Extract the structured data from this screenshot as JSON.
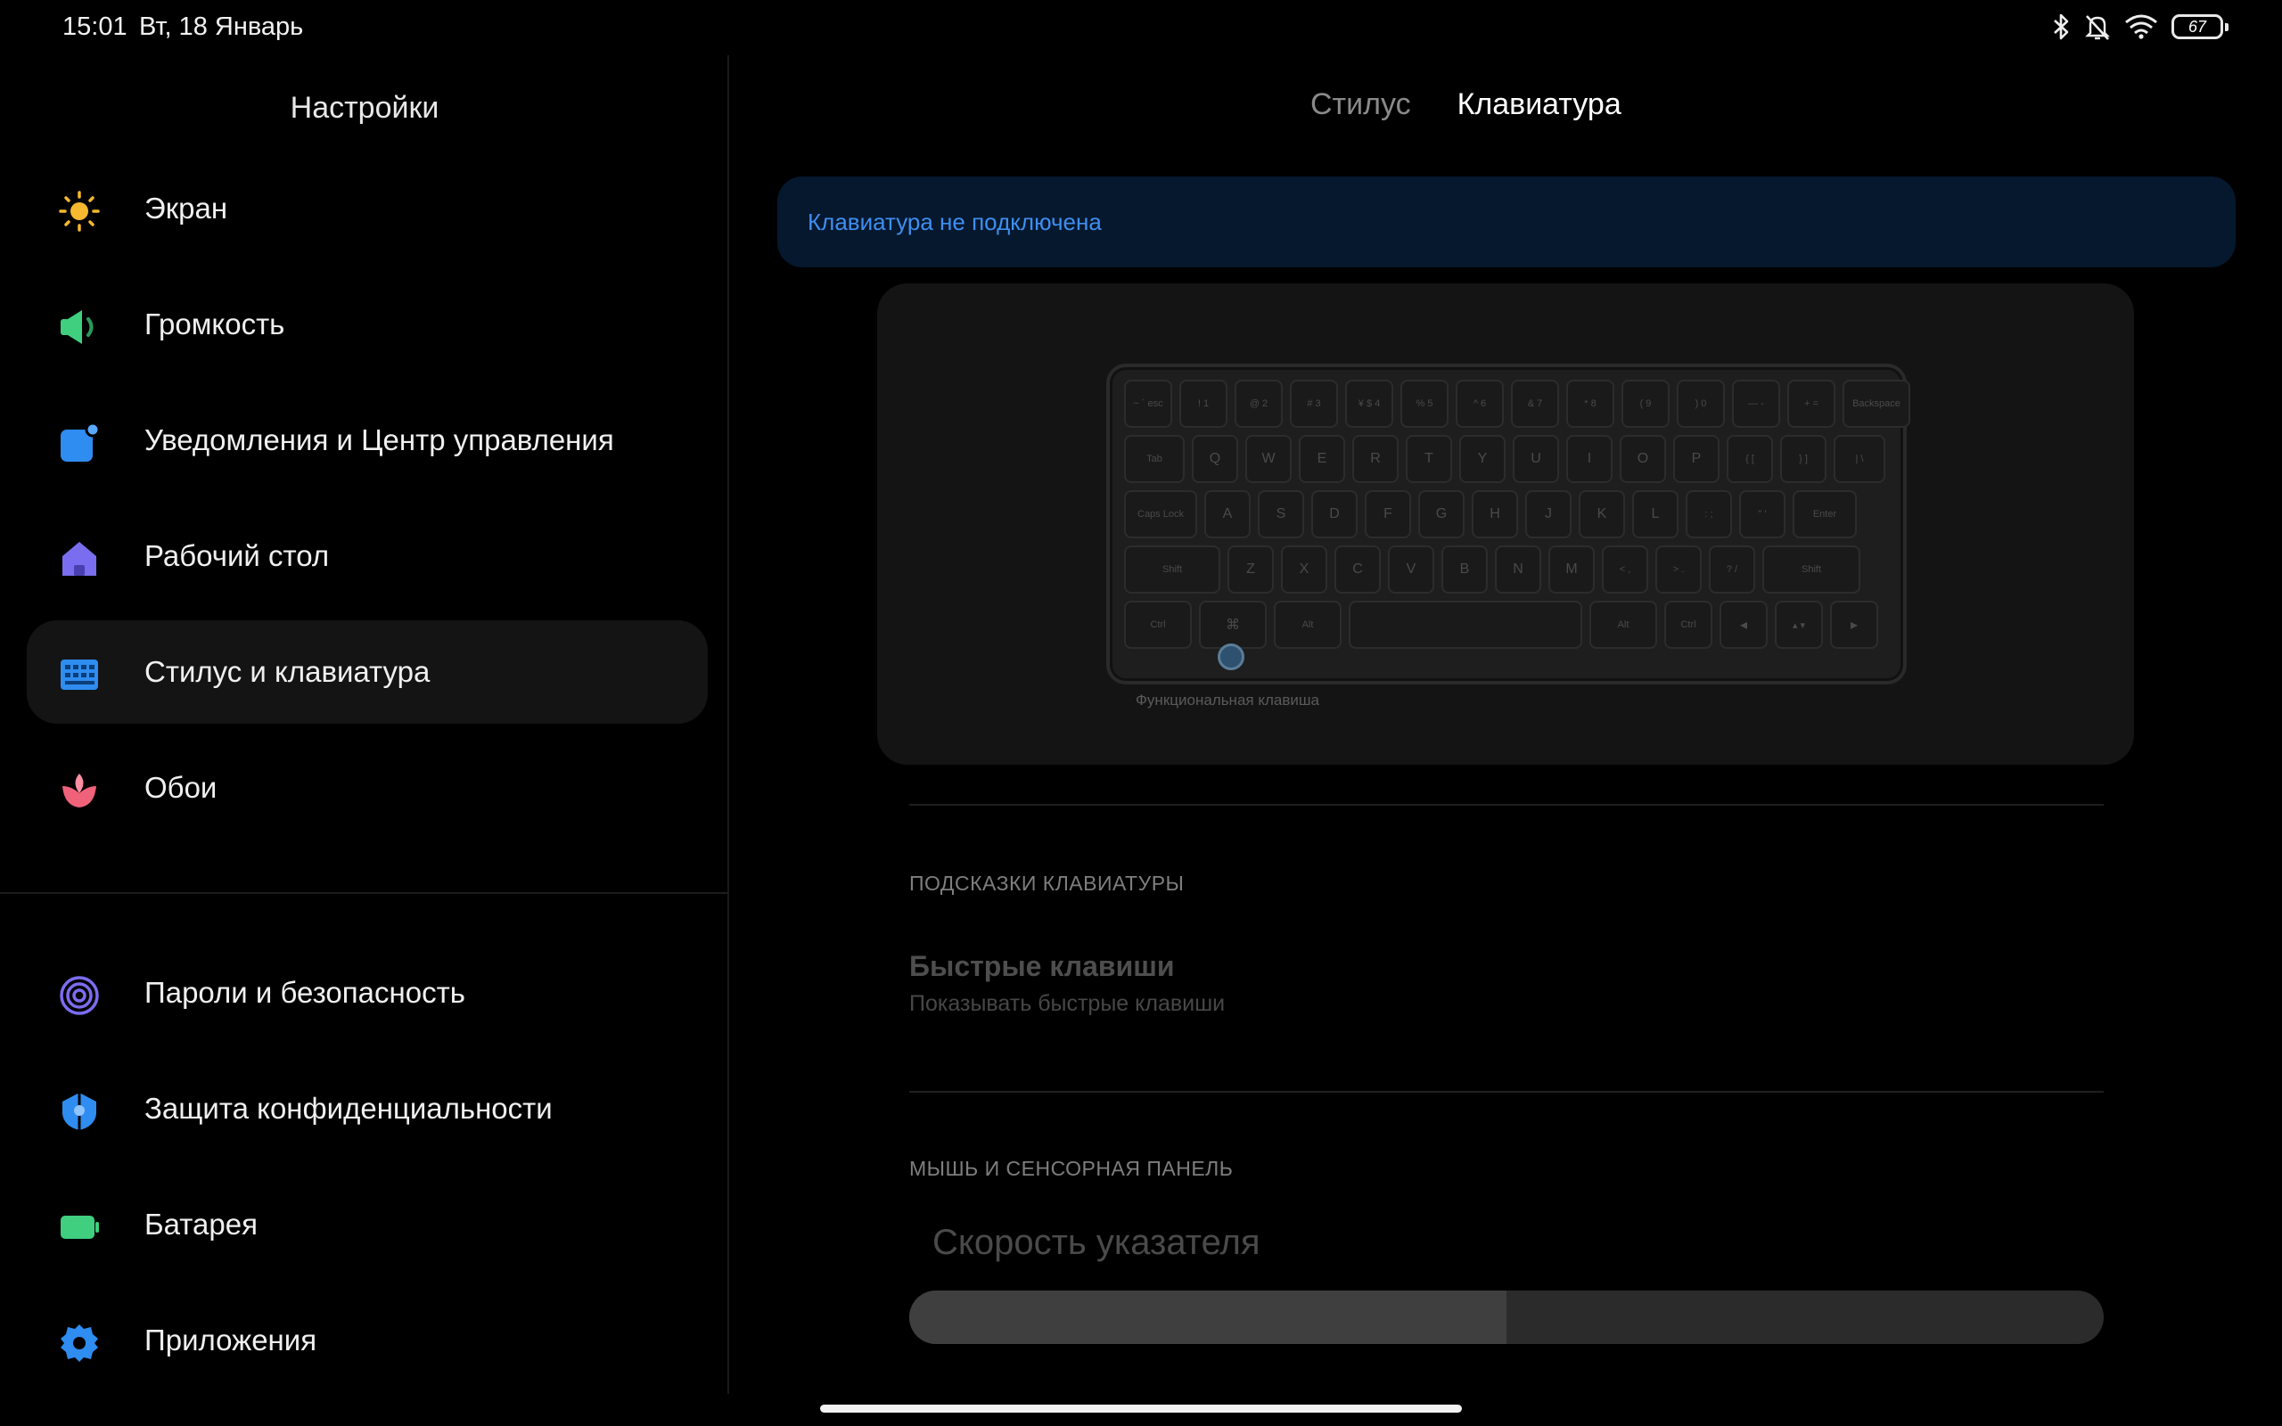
{
  "status_bar": {
    "time": "15:01",
    "date": "Вт, 18 Январь",
    "battery": "67",
    "icons": [
      "bluetooth-icon",
      "bell-muted-icon",
      "wifi-icon",
      "battery-icon"
    ]
  },
  "sidebar": {
    "title": "Настройки",
    "items": [
      {
        "label": "Экран",
        "icon": "sun-icon",
        "color": "#f5b82e"
      },
      {
        "label": "Громкость",
        "icon": "speaker-icon",
        "color": "#3fcf7f"
      },
      {
        "label": "Уведомления и Центр управления",
        "icon": "notification-icon",
        "color": "#2f8cf0"
      },
      {
        "label": "Рабочий стол",
        "icon": "home-icon",
        "color": "#7b6df0"
      },
      {
        "label": "Стилус и клавиатура",
        "icon": "keyboard-icon",
        "color": "#2f8cf0",
        "selected": true
      },
      {
        "label": "Обои",
        "icon": "flower-icon",
        "color": "#f0617a"
      },
      {
        "label": "Пароли и безопасность",
        "icon": "fingerprint-icon",
        "color": "#7b6df0"
      },
      {
        "label": "Защита конфиденциальности",
        "icon": "privacy-icon",
        "color": "#2f8cf0"
      },
      {
        "label": "Батарея",
        "icon": "battery-icon",
        "color": "#3fcf7f"
      },
      {
        "label": "Приложения",
        "icon": "gear-icon",
        "color": "#2f8cf0"
      }
    ]
  },
  "tabs": [
    {
      "label": "Стилус",
      "active": false
    },
    {
      "label": "Клавиатура",
      "active": true
    }
  ],
  "banner": {
    "text": "Клавиатура не подключена",
    "color": "#3f8ef0"
  },
  "keyboard_image": {
    "caption": "Функциональная клавиша",
    "rows": [
      [
        "~ ` esc",
        "! 1",
        "@ 2",
        "# 3",
        "¥ $ 4",
        "% 5",
        "^ 6",
        "& 7",
        "* 8",
        "( 9",
        ") 0",
        "— -",
        "+ =",
        "Backspace"
      ],
      [
        "Tab",
        "Q",
        "W",
        "E",
        "R",
        "T",
        "Y",
        "U",
        "I",
        "O",
        "P",
        "{ [",
        "} ]",
        "| \\"
      ],
      [
        "Caps Lock",
        "A",
        "S",
        "D",
        "F",
        "G",
        "H",
        "J",
        "K",
        "L",
        ": ;",
        "\" '",
        "Enter"
      ],
      [
        "Shift",
        "Z",
        "X",
        "C",
        "V",
        "B",
        "N",
        "M",
        "< ,",
        "> .",
        "? /",
        "Shift"
      ],
      [
        "Ctrl",
        "⌘",
        "Alt",
        "",
        "Alt",
        "Ctrl",
        "◂",
        "▴ ▾",
        "▸"
      ]
    ]
  },
  "sections": {
    "hints_header": "ПОДСКАЗКИ КЛАВИАТУРЫ",
    "shortcuts_title": "Быстрые клавиши",
    "shortcuts_sub": "Показывать быстрые клавиши",
    "mouse_header": "МЫШЬ И СЕНСОРНАЯ ПАНЕЛЬ",
    "pointer_speed_label": "Скорость указателя",
    "pointer_speed_value": 0.5
  }
}
